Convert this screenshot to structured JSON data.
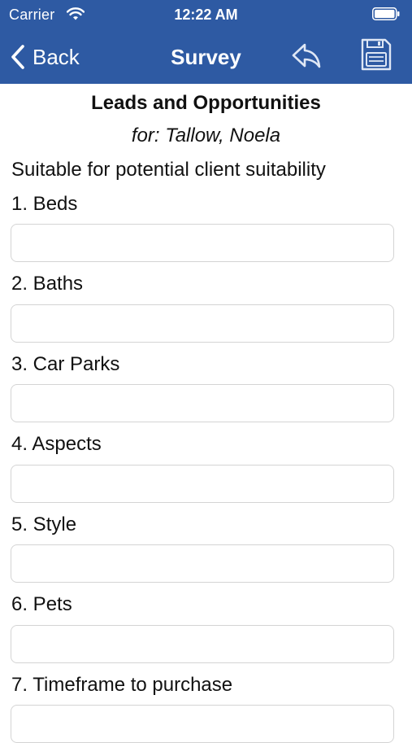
{
  "status_bar": {
    "carrier": "Carrier",
    "time": "12:22 AM"
  },
  "nav": {
    "back_label": "Back",
    "title": "Survey",
    "icons": [
      "chevron-left-icon",
      "reply-icon",
      "save-icon"
    ]
  },
  "survey": {
    "title": "Leads and Opportunities",
    "subtitle": "for: Tallow, Noela",
    "description": "Suitable for potential client suitability",
    "questions": [
      {
        "label": "1. Beds",
        "value": ""
      },
      {
        "label": "2. Baths",
        "value": ""
      },
      {
        "label": "3. Car Parks",
        "value": ""
      },
      {
        "label": "4. Aspects",
        "value": ""
      },
      {
        "label": "5. Style",
        "value": ""
      },
      {
        "label": "6. Pets",
        "value": ""
      },
      {
        "label": "7. Timeframe to purchase",
        "value": ""
      }
    ]
  },
  "colors": {
    "nav_background": "#2e5aa3",
    "nav_text": "#ffffff",
    "input_border": "#d4d4d4"
  }
}
